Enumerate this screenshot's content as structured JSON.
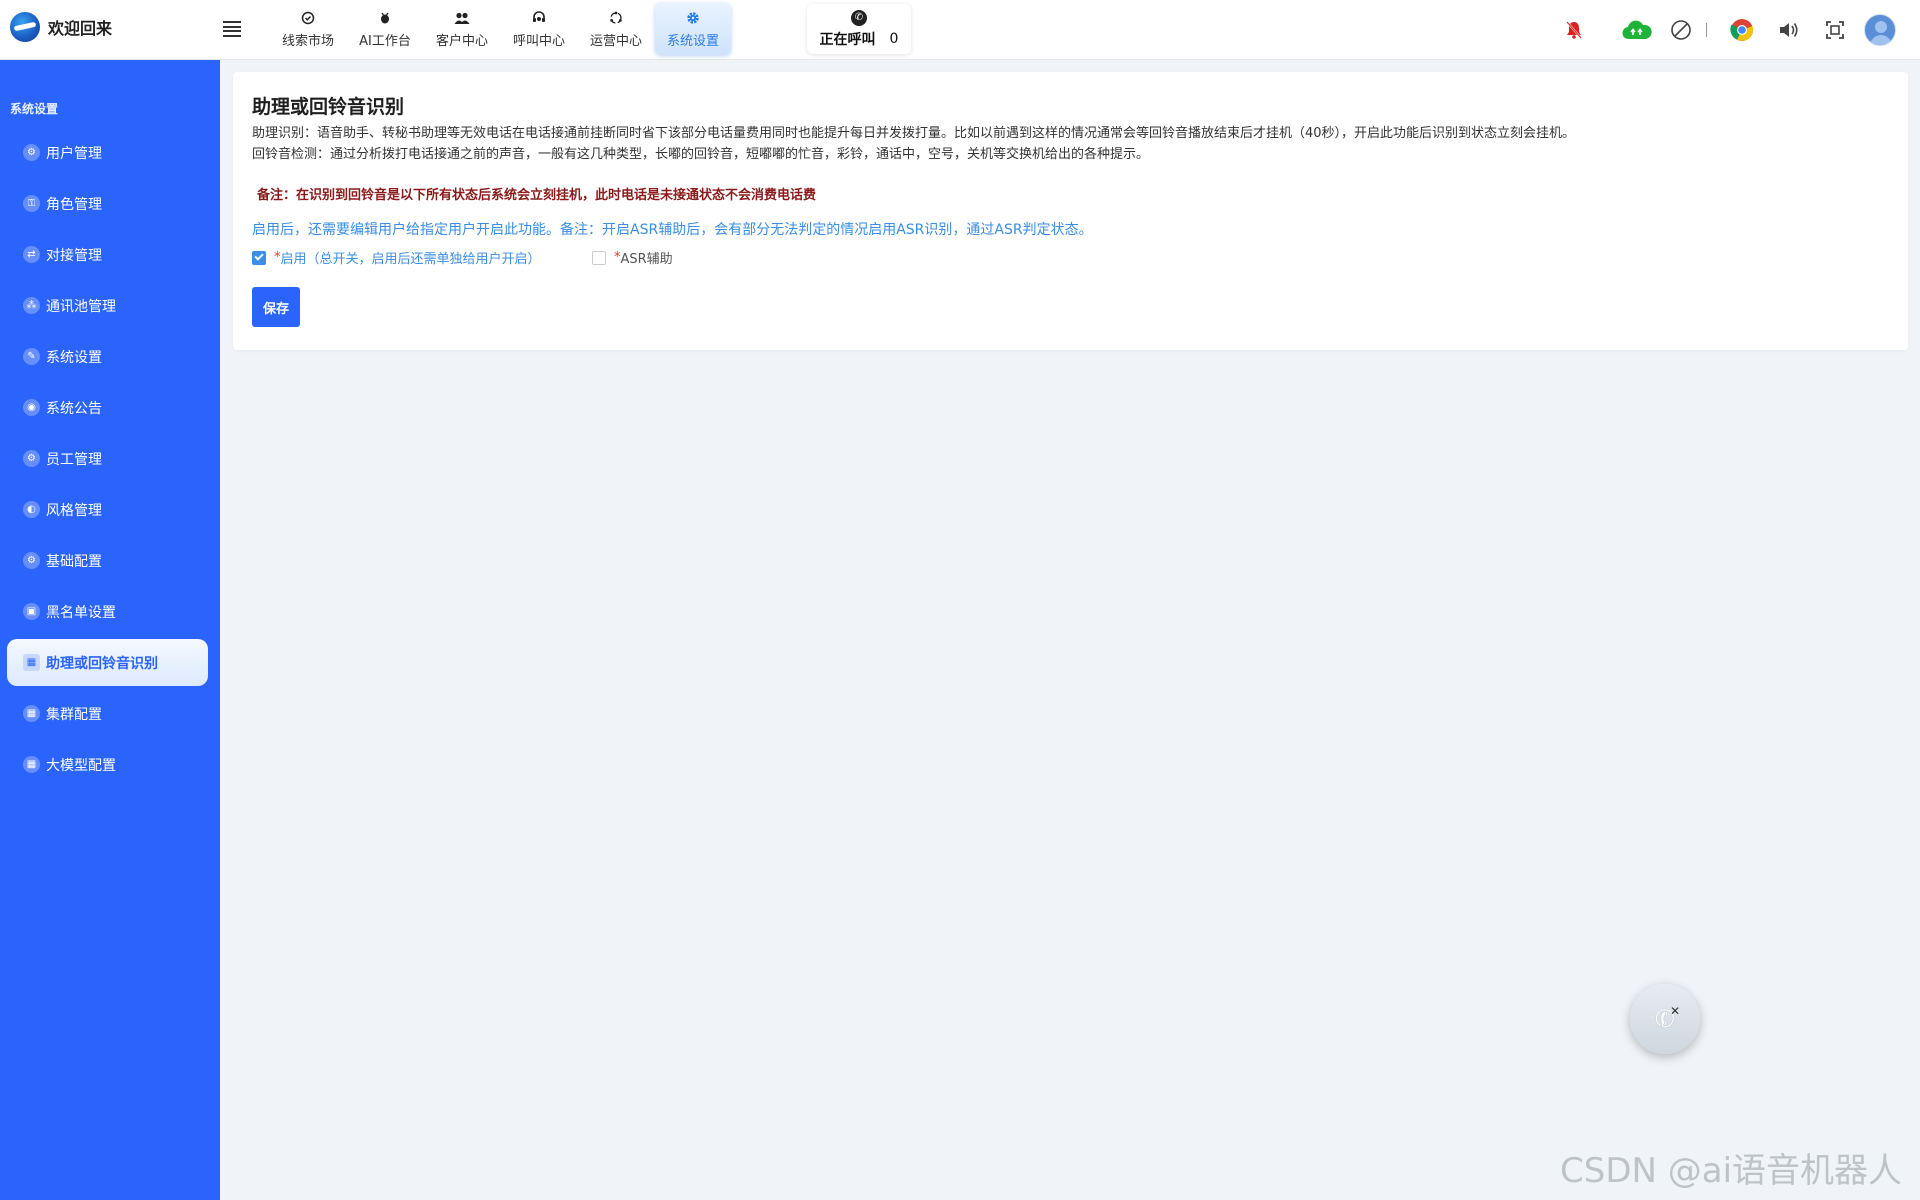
{
  "app": {
    "title": "欢迎回来",
    "logo_icon": "globe-logo-icon"
  },
  "nav": {
    "items": [
      {
        "label": "线索市场",
        "icon": "check-circle-icon"
      },
      {
        "label": "AI工作台",
        "icon": "bug-icon"
      },
      {
        "label": "客户中心",
        "icon": "users-icon"
      },
      {
        "label": "呼叫中心",
        "icon": "headset-icon"
      },
      {
        "label": "运营中心",
        "icon": "cycle-icon"
      },
      {
        "label": "系统设置",
        "icon": "gear-icon",
        "active": true
      }
    ]
  },
  "calling": {
    "label": "正在呼叫",
    "count": "0"
  },
  "toolbar_icons": [
    "bell-off-icon",
    "cloud-upload-icon",
    "block-icon",
    "chrome-icon",
    "speaker-icon",
    "fullscreen-icon",
    "avatar"
  ],
  "sidebar": {
    "title": "系统设置",
    "items": [
      {
        "label": "用户管理"
      },
      {
        "label": "角色管理"
      },
      {
        "label": "对接管理"
      },
      {
        "label": "通讯池管理"
      },
      {
        "label": "系统设置"
      },
      {
        "label": "系统公告"
      },
      {
        "label": "员工管理"
      },
      {
        "label": "风格管理"
      },
      {
        "label": "基础配置"
      },
      {
        "label": "黑名单设置"
      },
      {
        "label": "助理或回铃音识别",
        "active": true
      },
      {
        "label": "集群配置"
      },
      {
        "label": "大模型配置"
      }
    ]
  },
  "main": {
    "title": "助理或回铃音识别",
    "desc1": "助理识别：语音助手、转秘书助理等无效电话在电话接通前挂断同时省下该部分电话量费用同时也能提升每日并发拨打量。比如以前遇到这样的情况通常会等回铃音播放结束后才挂机（40秒），开启此功能后识别到状态立刻会挂机。",
    "desc2": "回铃音检测：通过分析拨打电话接通之前的声音，一般有这几种类型，长嘟的回铃音，短嘟嘟的忙音，彩铃，通话中，空号，关机等交换机给出的各种提示。",
    "note": "备注：在识别到回铃音是以下所有状态后系统会立刻挂机，此时电话是未接通状态不会消费电话费",
    "hint": "启用后，还需要编辑用户给指定用户开启此功能。备注：开启ASR辅助后，会有部分无法判定的情况启用ASR识别，通过ASR判定状态。",
    "enable": {
      "required": "*",
      "label": "启用（总开关，启用后还需单独给用户开启）",
      "checked": true
    },
    "asr": {
      "required": "*",
      "label": "ASR辅助",
      "checked": false
    },
    "save_label": "保存"
  },
  "watermark": "CSDN @ai语音机器人",
  "colors": {
    "sidebar_bg": "#2b64fd",
    "accent": "#3a8ee6",
    "note": "#8b1a1a",
    "bell": "#e02020",
    "cloud": "#1fb33a"
  }
}
